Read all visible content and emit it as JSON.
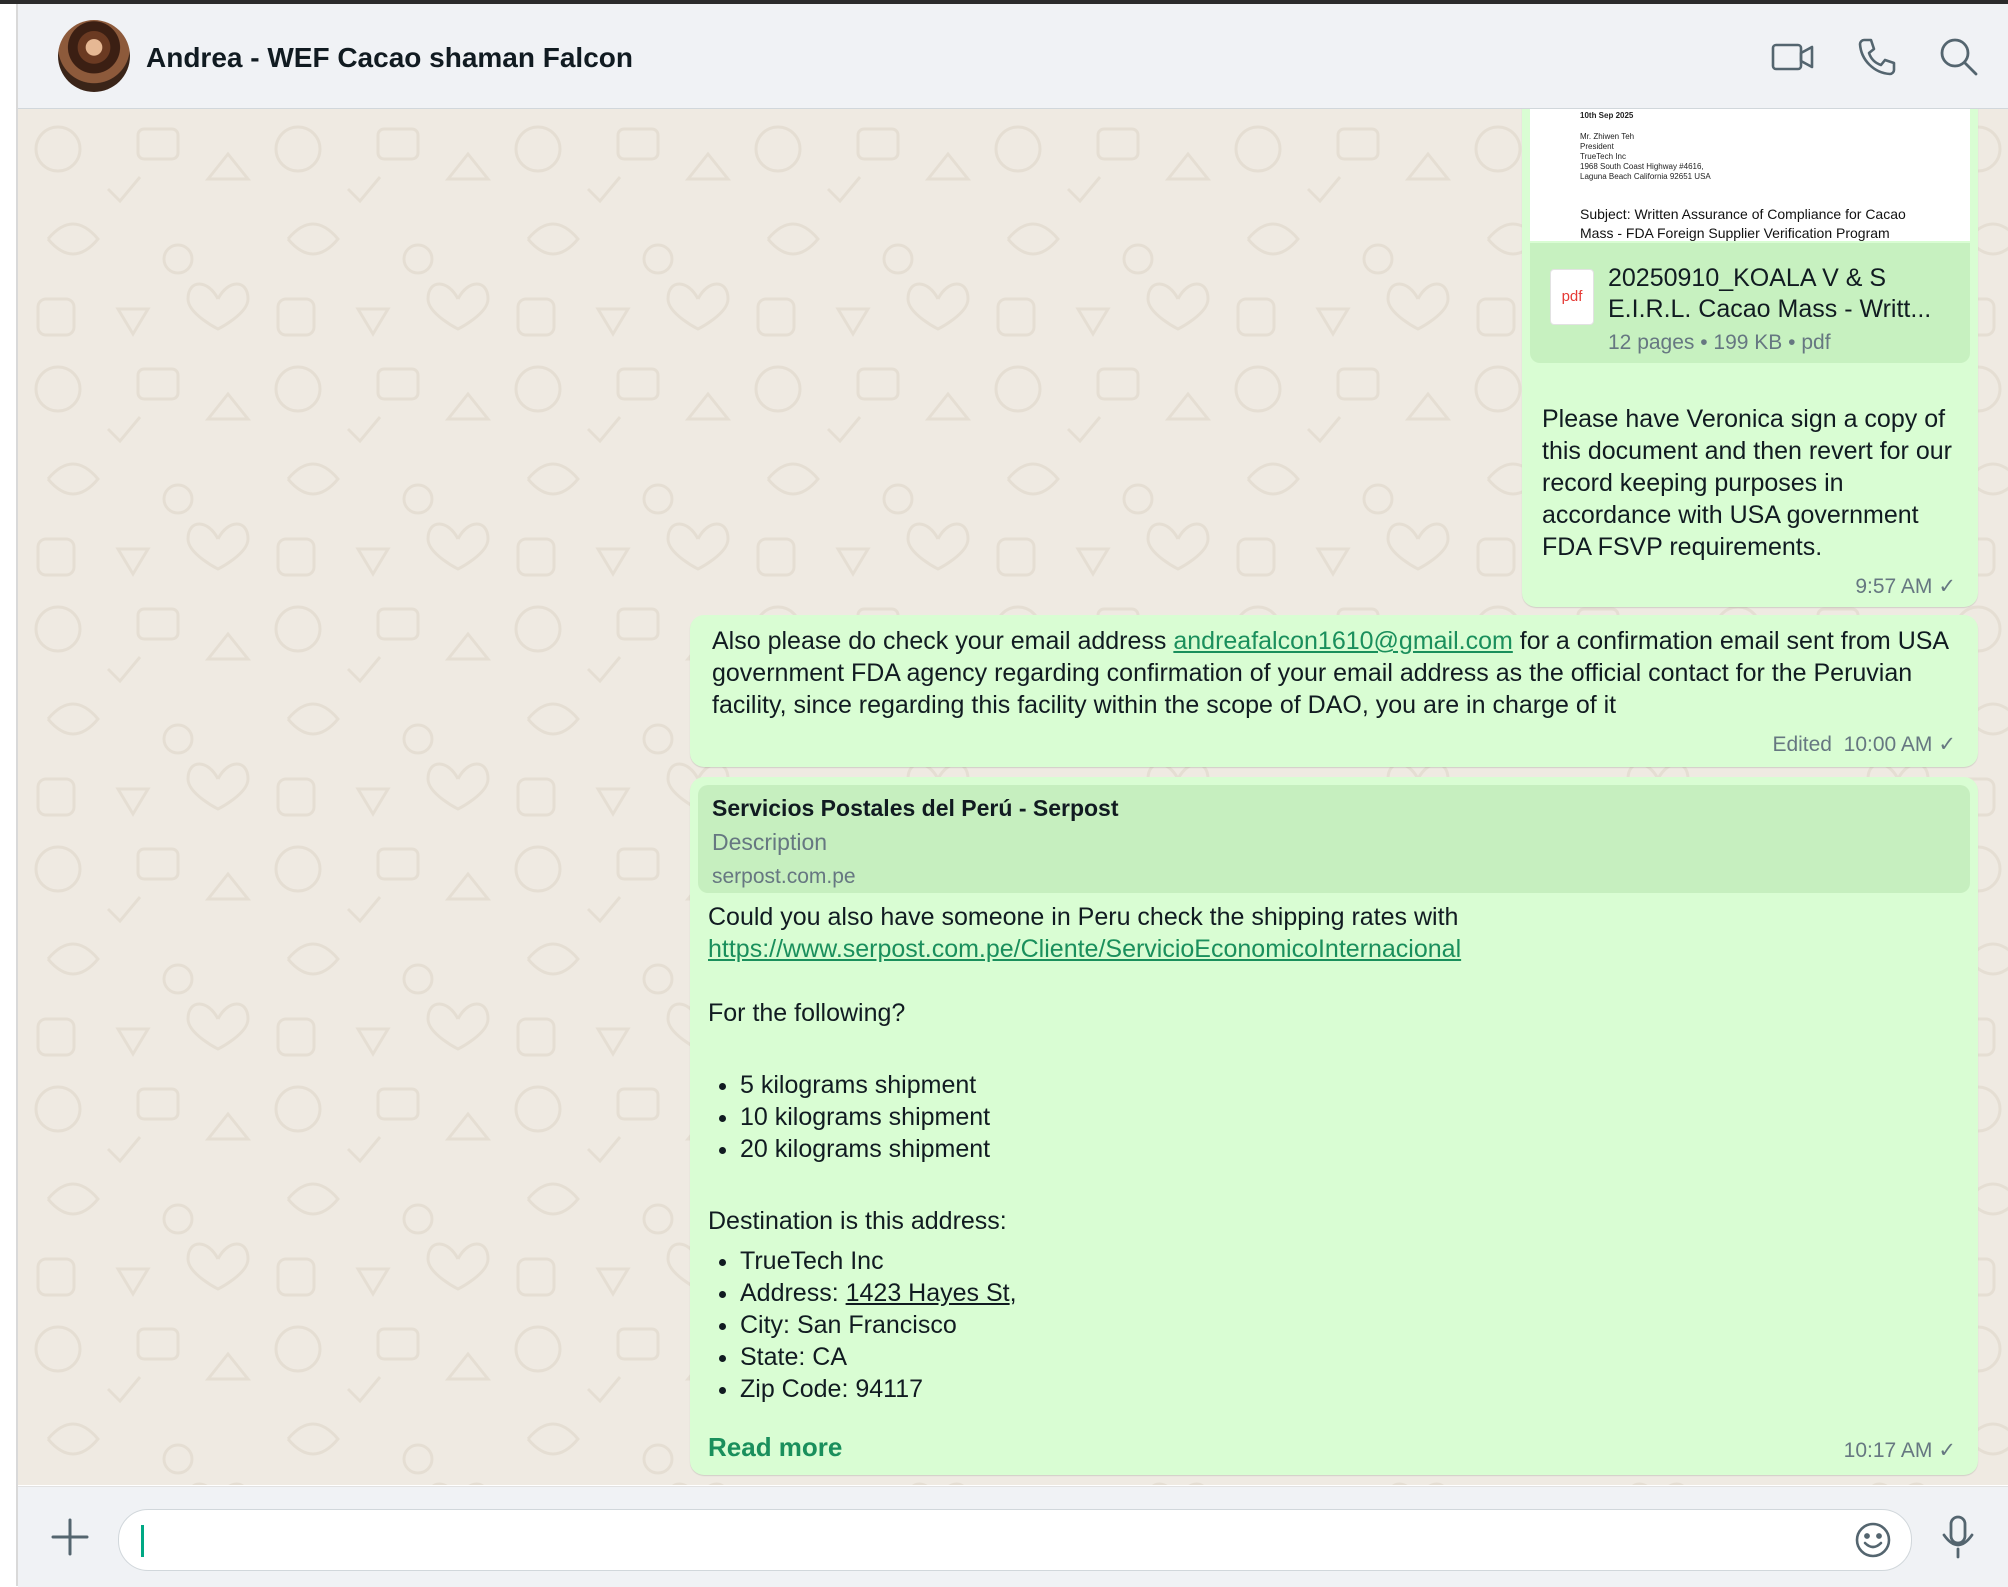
{
  "header": {
    "contact_name": "Andrea - WEF Cacao shaman Falcon",
    "icons": [
      "video-call-icon",
      "voice-call-icon",
      "search-icon"
    ]
  },
  "messages": {
    "document": {
      "preview_date": "10th Sep 2025",
      "preview_recipient": [
        "Mr. Zhiwen Teh",
        "President",
        "TrueTech Inc",
        "1968 South Coast Highway #4616,",
        "Laguna Beach California 92651 USA"
      ],
      "preview_subject": "Subject: Written Assurance of Compliance for Cacao Mass - FDA Foreign Supplier Verification Program",
      "file_icon": "pdf",
      "file_name": "20250910_KOALA V & S E.I.R.L. Cacao Mass - Writt...",
      "file_info": "12 pages • 199 KB • pdf",
      "caption": "Please have Veronica sign a copy of this document and then revert for our record keeping purposes in accordance with USA government FDA FSVP requirements.",
      "time": "9:57 AM"
    },
    "email_msg": {
      "text_before": "Also please do check your email address ",
      "email": "andreafalcon1610@gmail.com",
      "text_after": " for a confirmation email sent from USA government FDA agency regarding confirmation of your email address as the official contact for the Peruvian facility, since regarding this facility within the scope of DAO, you are in charge of it",
      "edited_label": "Edited",
      "time": "10:00 AM"
    },
    "shipping_msg": {
      "preview_title": "Servicios Postales del Perú - Serpost",
      "preview_description": "Description",
      "preview_domain": "serpost.com.pe",
      "intro": "Could you also have someone in Peru check the shipping rates with",
      "url": "https://www.serpost.com.pe/Cliente/ServicioEconomicoInternacional",
      "question": "For the following?",
      "items": [
        "5 kilograms shipment",
        "10 kilograms shipment",
        "20 kilograms shipment"
      ],
      "destination_label": "Destination is this address:",
      "address_company": "TrueTech Inc",
      "address_label": "Address: ",
      "address_street": "1423 Hayes St",
      "address_comma": ",",
      "address_city": "City: San Francisco",
      "address_state": "State: CA",
      "address_zip": "Zip Code: 94117",
      "read_more": "Read more",
      "time": "10:17 AM"
    }
  },
  "composer": {
    "value": "",
    "icons": [
      "plus-icon",
      "emoji-icon",
      "microphone-icon"
    ]
  },
  "colors": {
    "outgoing_bubble": "#d9fdd3",
    "chat_background": "#efeae2",
    "header_background": "#f0f2f5",
    "link_green": "#1a8f5c"
  }
}
